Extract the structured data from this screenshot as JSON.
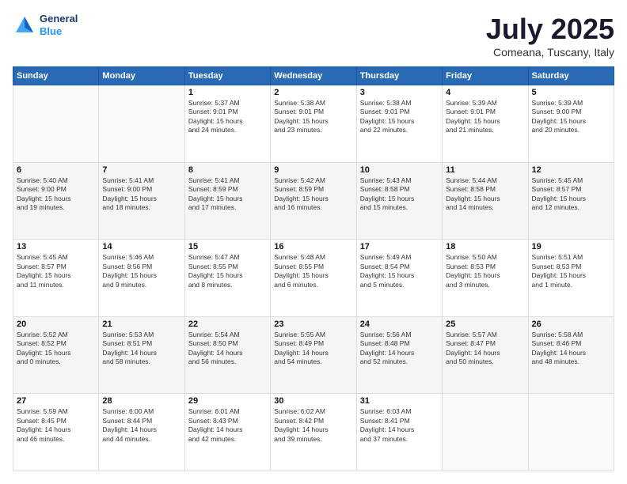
{
  "header": {
    "logo_line1": "General",
    "logo_line2": "Blue",
    "month": "July 2025",
    "location": "Comeana, Tuscany, Italy"
  },
  "days_of_week": [
    "Sunday",
    "Monday",
    "Tuesday",
    "Wednesday",
    "Thursday",
    "Friday",
    "Saturday"
  ],
  "weeks": [
    [
      {
        "day": "",
        "info": ""
      },
      {
        "day": "",
        "info": ""
      },
      {
        "day": "1",
        "info": "Sunrise: 5:37 AM\nSunset: 9:01 PM\nDaylight: 15 hours\nand 24 minutes."
      },
      {
        "day": "2",
        "info": "Sunrise: 5:38 AM\nSunset: 9:01 PM\nDaylight: 15 hours\nand 23 minutes."
      },
      {
        "day": "3",
        "info": "Sunrise: 5:38 AM\nSunset: 9:01 PM\nDaylight: 15 hours\nand 22 minutes."
      },
      {
        "day": "4",
        "info": "Sunrise: 5:39 AM\nSunset: 9:01 PM\nDaylight: 15 hours\nand 21 minutes."
      },
      {
        "day": "5",
        "info": "Sunrise: 5:39 AM\nSunset: 9:00 PM\nDaylight: 15 hours\nand 20 minutes."
      }
    ],
    [
      {
        "day": "6",
        "info": "Sunrise: 5:40 AM\nSunset: 9:00 PM\nDaylight: 15 hours\nand 19 minutes."
      },
      {
        "day": "7",
        "info": "Sunrise: 5:41 AM\nSunset: 9:00 PM\nDaylight: 15 hours\nand 18 minutes."
      },
      {
        "day": "8",
        "info": "Sunrise: 5:41 AM\nSunset: 8:59 PM\nDaylight: 15 hours\nand 17 minutes."
      },
      {
        "day": "9",
        "info": "Sunrise: 5:42 AM\nSunset: 8:59 PM\nDaylight: 15 hours\nand 16 minutes."
      },
      {
        "day": "10",
        "info": "Sunrise: 5:43 AM\nSunset: 8:58 PM\nDaylight: 15 hours\nand 15 minutes."
      },
      {
        "day": "11",
        "info": "Sunrise: 5:44 AM\nSunset: 8:58 PM\nDaylight: 15 hours\nand 14 minutes."
      },
      {
        "day": "12",
        "info": "Sunrise: 5:45 AM\nSunset: 8:57 PM\nDaylight: 15 hours\nand 12 minutes."
      }
    ],
    [
      {
        "day": "13",
        "info": "Sunrise: 5:45 AM\nSunset: 8:57 PM\nDaylight: 15 hours\nand 11 minutes."
      },
      {
        "day": "14",
        "info": "Sunrise: 5:46 AM\nSunset: 8:56 PM\nDaylight: 15 hours\nand 9 minutes."
      },
      {
        "day": "15",
        "info": "Sunrise: 5:47 AM\nSunset: 8:55 PM\nDaylight: 15 hours\nand 8 minutes."
      },
      {
        "day": "16",
        "info": "Sunrise: 5:48 AM\nSunset: 8:55 PM\nDaylight: 15 hours\nand 6 minutes."
      },
      {
        "day": "17",
        "info": "Sunrise: 5:49 AM\nSunset: 8:54 PM\nDaylight: 15 hours\nand 5 minutes."
      },
      {
        "day": "18",
        "info": "Sunrise: 5:50 AM\nSunset: 8:53 PM\nDaylight: 15 hours\nand 3 minutes."
      },
      {
        "day": "19",
        "info": "Sunrise: 5:51 AM\nSunset: 8:53 PM\nDaylight: 15 hours\nand 1 minute."
      }
    ],
    [
      {
        "day": "20",
        "info": "Sunrise: 5:52 AM\nSunset: 8:52 PM\nDaylight: 15 hours\nand 0 minutes."
      },
      {
        "day": "21",
        "info": "Sunrise: 5:53 AM\nSunset: 8:51 PM\nDaylight: 14 hours\nand 58 minutes."
      },
      {
        "day": "22",
        "info": "Sunrise: 5:54 AM\nSunset: 8:50 PM\nDaylight: 14 hours\nand 56 minutes."
      },
      {
        "day": "23",
        "info": "Sunrise: 5:55 AM\nSunset: 8:49 PM\nDaylight: 14 hours\nand 54 minutes."
      },
      {
        "day": "24",
        "info": "Sunrise: 5:56 AM\nSunset: 8:48 PM\nDaylight: 14 hours\nand 52 minutes."
      },
      {
        "day": "25",
        "info": "Sunrise: 5:57 AM\nSunset: 8:47 PM\nDaylight: 14 hours\nand 50 minutes."
      },
      {
        "day": "26",
        "info": "Sunrise: 5:58 AM\nSunset: 8:46 PM\nDaylight: 14 hours\nand 48 minutes."
      }
    ],
    [
      {
        "day": "27",
        "info": "Sunrise: 5:59 AM\nSunset: 8:45 PM\nDaylight: 14 hours\nand 46 minutes."
      },
      {
        "day": "28",
        "info": "Sunrise: 6:00 AM\nSunset: 8:44 PM\nDaylight: 14 hours\nand 44 minutes."
      },
      {
        "day": "29",
        "info": "Sunrise: 6:01 AM\nSunset: 8:43 PM\nDaylight: 14 hours\nand 42 minutes."
      },
      {
        "day": "30",
        "info": "Sunrise: 6:02 AM\nSunset: 8:42 PM\nDaylight: 14 hours\nand 39 minutes."
      },
      {
        "day": "31",
        "info": "Sunrise: 6:03 AM\nSunset: 8:41 PM\nDaylight: 14 hours\nand 37 minutes."
      },
      {
        "day": "",
        "info": ""
      },
      {
        "day": "",
        "info": ""
      }
    ]
  ]
}
